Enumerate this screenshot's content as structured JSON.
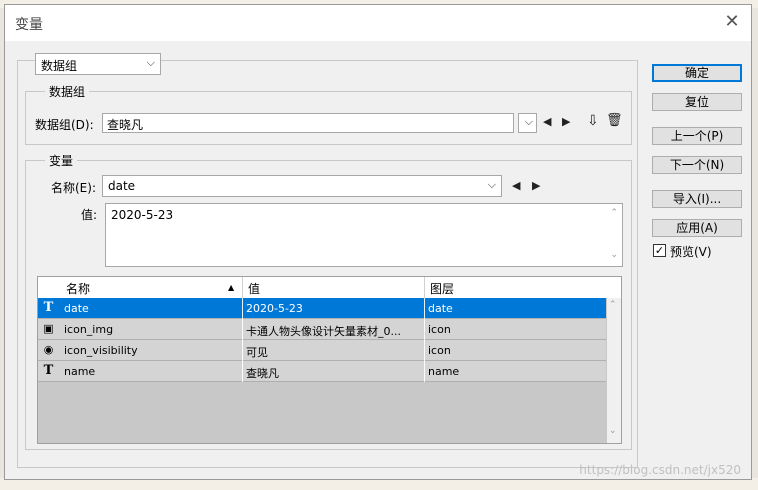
{
  "window": {
    "title": "变量",
    "close_glyph": "✕"
  },
  "top_select": {
    "value": "数据组"
  },
  "dataset_group": {
    "legend": "数据组",
    "label": "数据组(D):",
    "value": "查晓凡"
  },
  "variable_group": {
    "legend": "变量",
    "name_label": "名称(E):",
    "name_value": "date",
    "value_label": "值:",
    "value_text": "2020-5-23"
  },
  "table": {
    "columns": [
      "名称",
      "值",
      "图层"
    ],
    "sort_glyph": "▲",
    "rows": [
      {
        "icon": "text-variable-icon",
        "glyph": "T",
        "name": "date",
        "value": "2020-5-23",
        "layer": "date",
        "selected": true
      },
      {
        "icon": "image-variable-icon",
        "glyph": "▣",
        "name": "icon_img",
        "value": "卡通人物头像设计矢量素材_0...",
        "layer": "icon",
        "selected": false
      },
      {
        "icon": "visibility-variable-icon",
        "glyph": "◉",
        "name": "icon_visibility",
        "value": "可见",
        "layer": "icon",
        "selected": false
      },
      {
        "icon": "text-variable-icon",
        "glyph": "T",
        "name": "name",
        "value": "查晓凡",
        "layer": "name",
        "selected": false
      }
    ]
  },
  "buttons": {
    "ok": "确定",
    "reset": "复位",
    "prev": "上一个(P)",
    "next": "下一个(N)",
    "import": "导入(I)...",
    "apply": "应用(A)"
  },
  "preview": {
    "label": "预览(V)",
    "checked": true
  },
  "watermark": "https://blog.csdn.net/jx520",
  "colors": {
    "selection": "#0078d7",
    "dialog_bg": "#f0f0f0"
  }
}
